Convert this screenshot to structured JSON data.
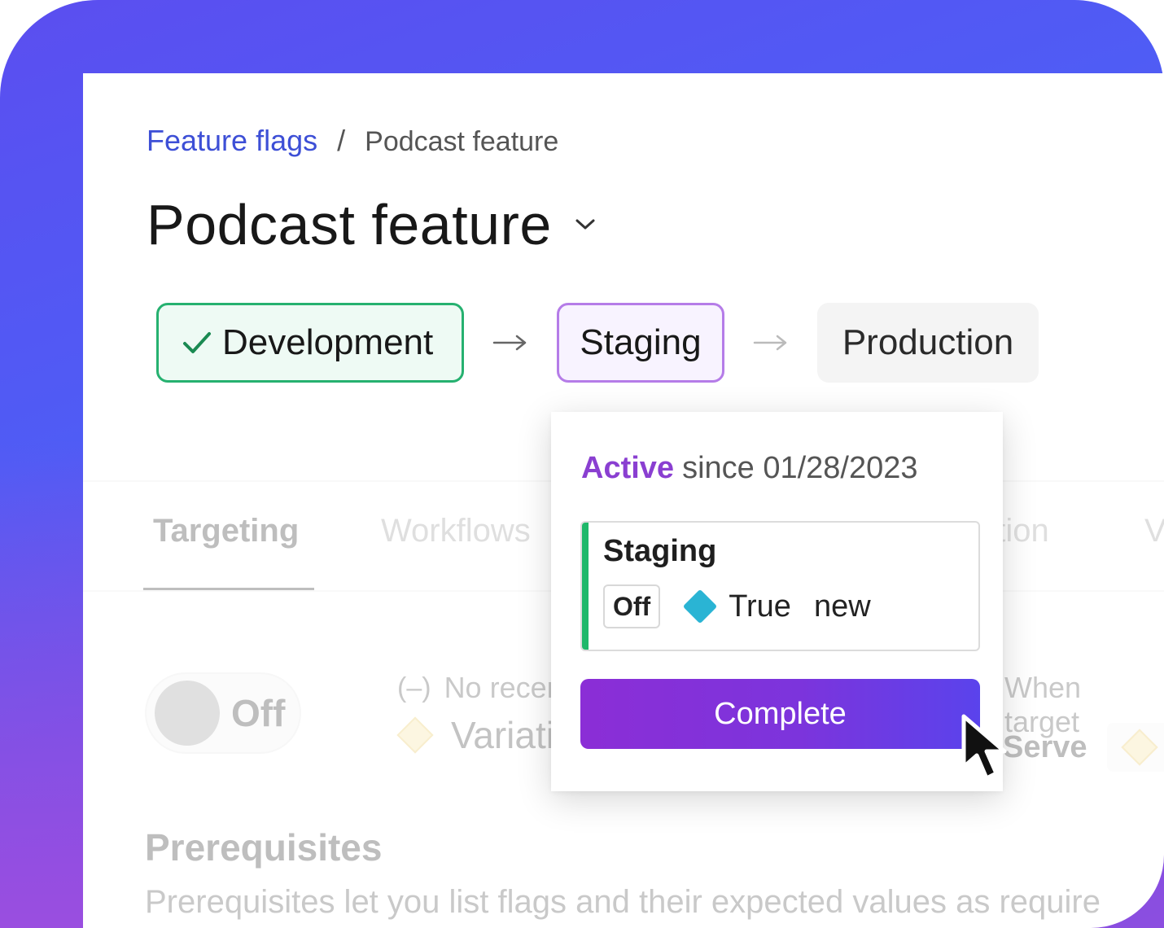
{
  "breadcrumb": {
    "parent": "Feature flags",
    "separator": "/",
    "current": "Podcast feature"
  },
  "page": {
    "title": "Podcast feature"
  },
  "stages": [
    {
      "label": "Development",
      "status": "complete"
    },
    {
      "label": "Staging",
      "status": "active"
    },
    {
      "label": "Production",
      "status": "pending"
    }
  ],
  "tabs": [
    {
      "label": "Targeting"
    },
    {
      "label": "Workflows"
    },
    {
      "label": "ation"
    },
    {
      "label": "V"
    }
  ],
  "targeting": {
    "toggle_label": "Off",
    "no_recent": "No recen",
    "variation": "Variati",
    "when_targeting": "When target",
    "serve": "Serve"
  },
  "prerequisites": {
    "title": "Prerequisites",
    "description": "Prerequisites let you list flags and their expected values as require"
  },
  "popover": {
    "active_word": "Active",
    "active_since": "since 01/28/2023",
    "card_title": "Staging",
    "off_chip": "Off",
    "true_label": "True",
    "new_label": "new",
    "complete_button": "Complete"
  },
  "colors": {
    "accent_purple": "#8a3fd1",
    "link_blue": "#3d4fd6",
    "success_green": "#26b170",
    "variation_blue": "#2ab4d4"
  }
}
